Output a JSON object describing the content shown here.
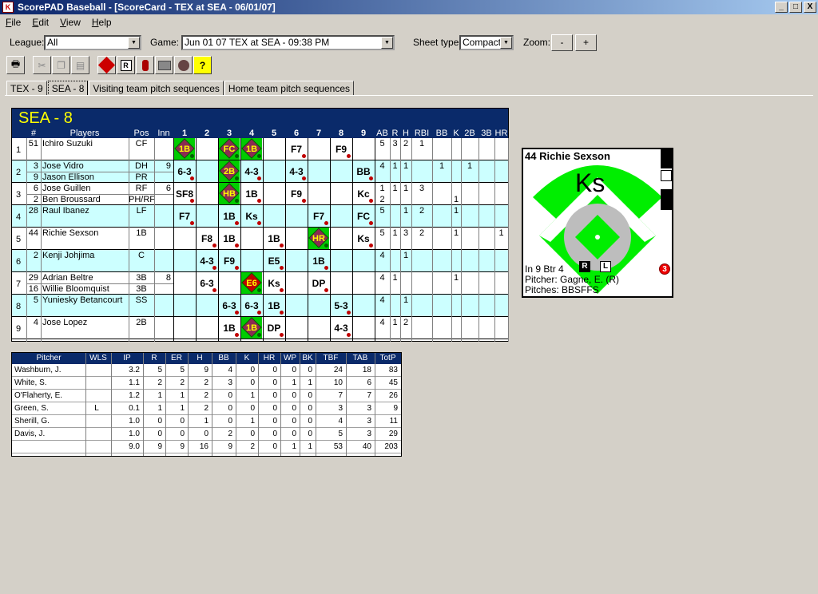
{
  "window": {
    "title": "ScorePAD Baseball - [ScoreCard - TEX at SEA - 06/01/07]",
    "min": "_",
    "max": "□",
    "close": "X"
  },
  "menu": [
    "File",
    "Edit",
    "View",
    "Help"
  ],
  "filters": {
    "league_label": "League:",
    "league_value": "All",
    "game_label": "Game:",
    "game_value": "Jun 01 07  TEX at SEA - 09:38 PM",
    "sheet_label": "Sheet type:",
    "sheet_value": "Compact",
    "zoom_label": "Zoom:",
    "zoom_minus": "-",
    "zoom_plus": "+"
  },
  "toolbar": [
    "print-icon",
    "cut-icon",
    "copy-icon",
    "paste-icon",
    "hr-icon",
    "r-icon",
    "runner-icon",
    "stadium-icon",
    "glove-icon",
    "help-icon"
  ],
  "tabs": [
    "TEX - 9",
    "SEA - 8",
    "Visiting team pitch sequences",
    "Home team pitch sequences"
  ],
  "scorecard": {
    "team": "SEA - 8",
    "headers": {
      "num": "#",
      "players": "Players",
      "pos": "Pos",
      "inn": "Inn",
      "innings": [
        "1",
        "2",
        "3",
        "4",
        "5",
        "6",
        "7",
        "8",
        "9"
      ],
      "stats": [
        "AB",
        "R",
        "H",
        "RBI",
        "BB",
        "K",
        "2B",
        "3B",
        "HR"
      ]
    },
    "rows": [
      {
        "order": "1",
        "players": [
          {
            "num": "51",
            "name": "Ichiro Suzuki",
            "pos": "CF",
            "inn": ""
          }
        ],
        "stats": [
          "5",
          "3",
          "2",
          "1",
          "",
          "",
          "",
          "",
          ""
        ]
      },
      {
        "order": "2",
        "players": [
          {
            "num": "3",
            "name": "Jose Vidro",
            "pos": "DH",
            "inn": "9"
          },
          {
            "num": "9",
            "name": "Jason Ellison",
            "pos": "PR",
            "inn": ""
          }
        ],
        "stats": [
          "4",
          "1",
          "1",
          "",
          "1",
          "",
          "1",
          "",
          ""
        ]
      },
      {
        "order": "3",
        "players": [
          {
            "num": "6",
            "name": "Jose Guillen",
            "pos": "RF",
            "inn": "6"
          },
          {
            "num": "2",
            "name": "Ben Broussard",
            "pos": "PH/RF",
            "inn": ""
          }
        ],
        "stats": [
          "1",
          "1",
          "1",
          "3",
          "",
          "",
          "",
          "",
          ""
        ],
        "stats2": [
          "2",
          "",
          "",
          "",
          "",
          "1",
          "",
          "",
          ""
        ]
      },
      {
        "order": "4",
        "players": [
          {
            "num": "28",
            "name": "Raul Ibanez",
            "pos": "LF",
            "inn": ""
          }
        ],
        "stats": [
          "5",
          "",
          "1",
          "2",
          "",
          "1",
          "",
          "",
          ""
        ]
      },
      {
        "order": "5",
        "players": [
          {
            "num": "44",
            "name": "Richie Sexson",
            "pos": "1B",
            "inn": ""
          }
        ],
        "stats": [
          "5",
          "1",
          "3",
          "2",
          "",
          "1",
          "",
          "",
          "1"
        ]
      },
      {
        "order": "6",
        "players": [
          {
            "num": "2",
            "name": "Kenji Johjima",
            "pos": "C",
            "inn": ""
          }
        ],
        "stats": [
          "4",
          "",
          "1",
          "",
          "",
          "",
          "",
          "",
          ""
        ]
      },
      {
        "order": "7",
        "players": [
          {
            "num": "29",
            "name": "Adrian Beltre",
            "pos": "3B",
            "inn": "8"
          },
          {
            "num": "16",
            "name": "Willie Bloomquist",
            "pos": "3B",
            "inn": ""
          }
        ],
        "stats": [
          "4",
          "1",
          "",
          "",
          "",
          "1",
          "",
          "",
          ""
        ]
      },
      {
        "order": "8",
        "players": [
          {
            "num": "5",
            "name": "Yuniesky Betancourt",
            "pos": "SS",
            "inn": ""
          }
        ],
        "stats": [
          "4",
          "",
          "1",
          "",
          "",
          "",
          "",
          "",
          ""
        ]
      },
      {
        "order": "9",
        "players": [
          {
            "num": "4",
            "name": "Jose Lopez",
            "pos": "2B",
            "inn": ""
          }
        ],
        "stats": [
          "4",
          "1",
          "2",
          "",
          "",
          "",
          "",
          "",
          ""
        ]
      }
    ],
    "plays": [
      {
        "row": 0,
        "inning": 1,
        "text": "1B",
        "diamond": true
      },
      {
        "row": 0,
        "inning": 3,
        "text": "FC",
        "diamond": true
      },
      {
        "row": 0,
        "inning": 4,
        "text": "1B",
        "diamond": true
      },
      {
        "row": 0,
        "inning": 6,
        "text": "F7"
      },
      {
        "row": 0,
        "inning": 8,
        "text": "F9"
      },
      {
        "row": 1,
        "inning": 1,
        "text": "6-3"
      },
      {
        "row": 1,
        "inning": 3,
        "text": "2B",
        "diamond": true
      },
      {
        "row": 1,
        "inning": 4,
        "text": "4-3"
      },
      {
        "row": 1,
        "inning": 6,
        "text": "4-3"
      },
      {
        "row": 1,
        "inning": 9,
        "text": "BB"
      },
      {
        "row": 2,
        "inning": 1,
        "text": "SF8"
      },
      {
        "row": 2,
        "inning": 3,
        "text": "HB",
        "diamond": true
      },
      {
        "row": 2,
        "inning": 4,
        "text": "1B"
      },
      {
        "row": 2,
        "inning": 6,
        "text": "F9"
      },
      {
        "row": 2,
        "inning": 9,
        "text": "Kc"
      },
      {
        "row": 3,
        "inning": 1,
        "text": "F7"
      },
      {
        "row": 3,
        "inning": 3,
        "text": "1B"
      },
      {
        "row": 3,
        "inning": 4,
        "text": "Ks"
      },
      {
        "row": 3,
        "inning": 7,
        "text": "F7"
      },
      {
        "row": 3,
        "inning": 9,
        "text": "FC"
      },
      {
        "row": 4,
        "inning": 2,
        "text": "F8"
      },
      {
        "row": 4,
        "inning": 3,
        "text": "1B"
      },
      {
        "row": 4,
        "inning": 5,
        "text": "1B"
      },
      {
        "row": 4,
        "inning": 7,
        "text": "HR",
        "diamond": true
      },
      {
        "row": 4,
        "inning": 9,
        "text": "Ks"
      },
      {
        "row": 5,
        "inning": 2,
        "text": "4-3"
      },
      {
        "row": 5,
        "inning": 3,
        "text": "F9"
      },
      {
        "row": 5,
        "inning": 5,
        "text": "E5"
      },
      {
        "row": 5,
        "inning": 7,
        "text": "1B"
      },
      {
        "row": 6,
        "inning": 2,
        "text": "6-3"
      },
      {
        "row": 6,
        "inning": 4,
        "text": "E6",
        "diamond": true,
        "red": true
      },
      {
        "row": 6,
        "inning": 5,
        "text": "Ks"
      },
      {
        "row": 6,
        "inning": 7,
        "text": "DP"
      },
      {
        "row": 7,
        "inning": 3,
        "text": "6-3"
      },
      {
        "row": 7,
        "inning": 4,
        "text": "6-3"
      },
      {
        "row": 7,
        "inning": 5,
        "text": "1B"
      },
      {
        "row": 7,
        "inning": 8,
        "text": "5-3"
      },
      {
        "row": 8,
        "inning": 3,
        "text": "1B"
      },
      {
        "row": 8,
        "inning": 4,
        "text": "1B",
        "diamond": true
      },
      {
        "row": 8,
        "inning": 5,
        "text": "DP"
      },
      {
        "row": 8,
        "inning": 8,
        "text": "4-3"
      }
    ]
  },
  "pitchers": {
    "headers": [
      "Pitcher",
      "WLS",
      "IP",
      "R",
      "ER",
      "H",
      "BB",
      "K",
      "HR",
      "WP",
      "BK",
      "TBF",
      "TAB",
      "TotP"
    ],
    "rows": [
      [
        "Washburn, J.",
        "",
        "3.2",
        "5",
        "5",
        "9",
        "4",
        "0",
        "0",
        "0",
        "0",
        "24",
        "18",
        "83"
      ],
      [
        "White, S.",
        "",
        "1.1",
        "2",
        "2",
        "2",
        "3",
        "0",
        "0",
        "1",
        "1",
        "10",
        "6",
        "45"
      ],
      [
        "O'Flaherty, E.",
        "",
        "1.2",
        "1",
        "1",
        "2",
        "0",
        "1",
        "0",
        "0",
        "0",
        "7",
        "7",
        "26"
      ],
      [
        "Green, S.",
        "L",
        "0.1",
        "1",
        "1",
        "2",
        "0",
        "0",
        "0",
        "0",
        "0",
        "3",
        "3",
        "9"
      ],
      [
        "Sherill, G.",
        "",
        "1.0",
        "0",
        "0",
        "1",
        "0",
        "1",
        "0",
        "0",
        "0",
        "4",
        "3",
        "11"
      ],
      [
        "Davis, J.",
        "",
        "1.0",
        "0",
        "0",
        "0",
        "2",
        "0",
        "0",
        "0",
        "0",
        "5",
        "3",
        "29"
      ],
      [
        "",
        "",
        "9.0",
        "9",
        "9",
        "16",
        "9",
        "2",
        "0",
        "1",
        "1",
        "53",
        "40",
        "203"
      ]
    ]
  },
  "field": {
    "batter": "44 Richie Sexson",
    "play": "Ks",
    "inning": "In 9 Btr 4",
    "bat_r": "R",
    "bat_l": "L",
    "outs": "3",
    "pitcher": "Pitcher: Gagne, E. (R)",
    "pitches": "Pitches: BBSFFS"
  },
  "colors": {
    "header_navy": "#0a2a6a",
    "row_alt": "#ccffff",
    "hit_diamond": "#8b2b52",
    "field_green": "#00ee00"
  }
}
